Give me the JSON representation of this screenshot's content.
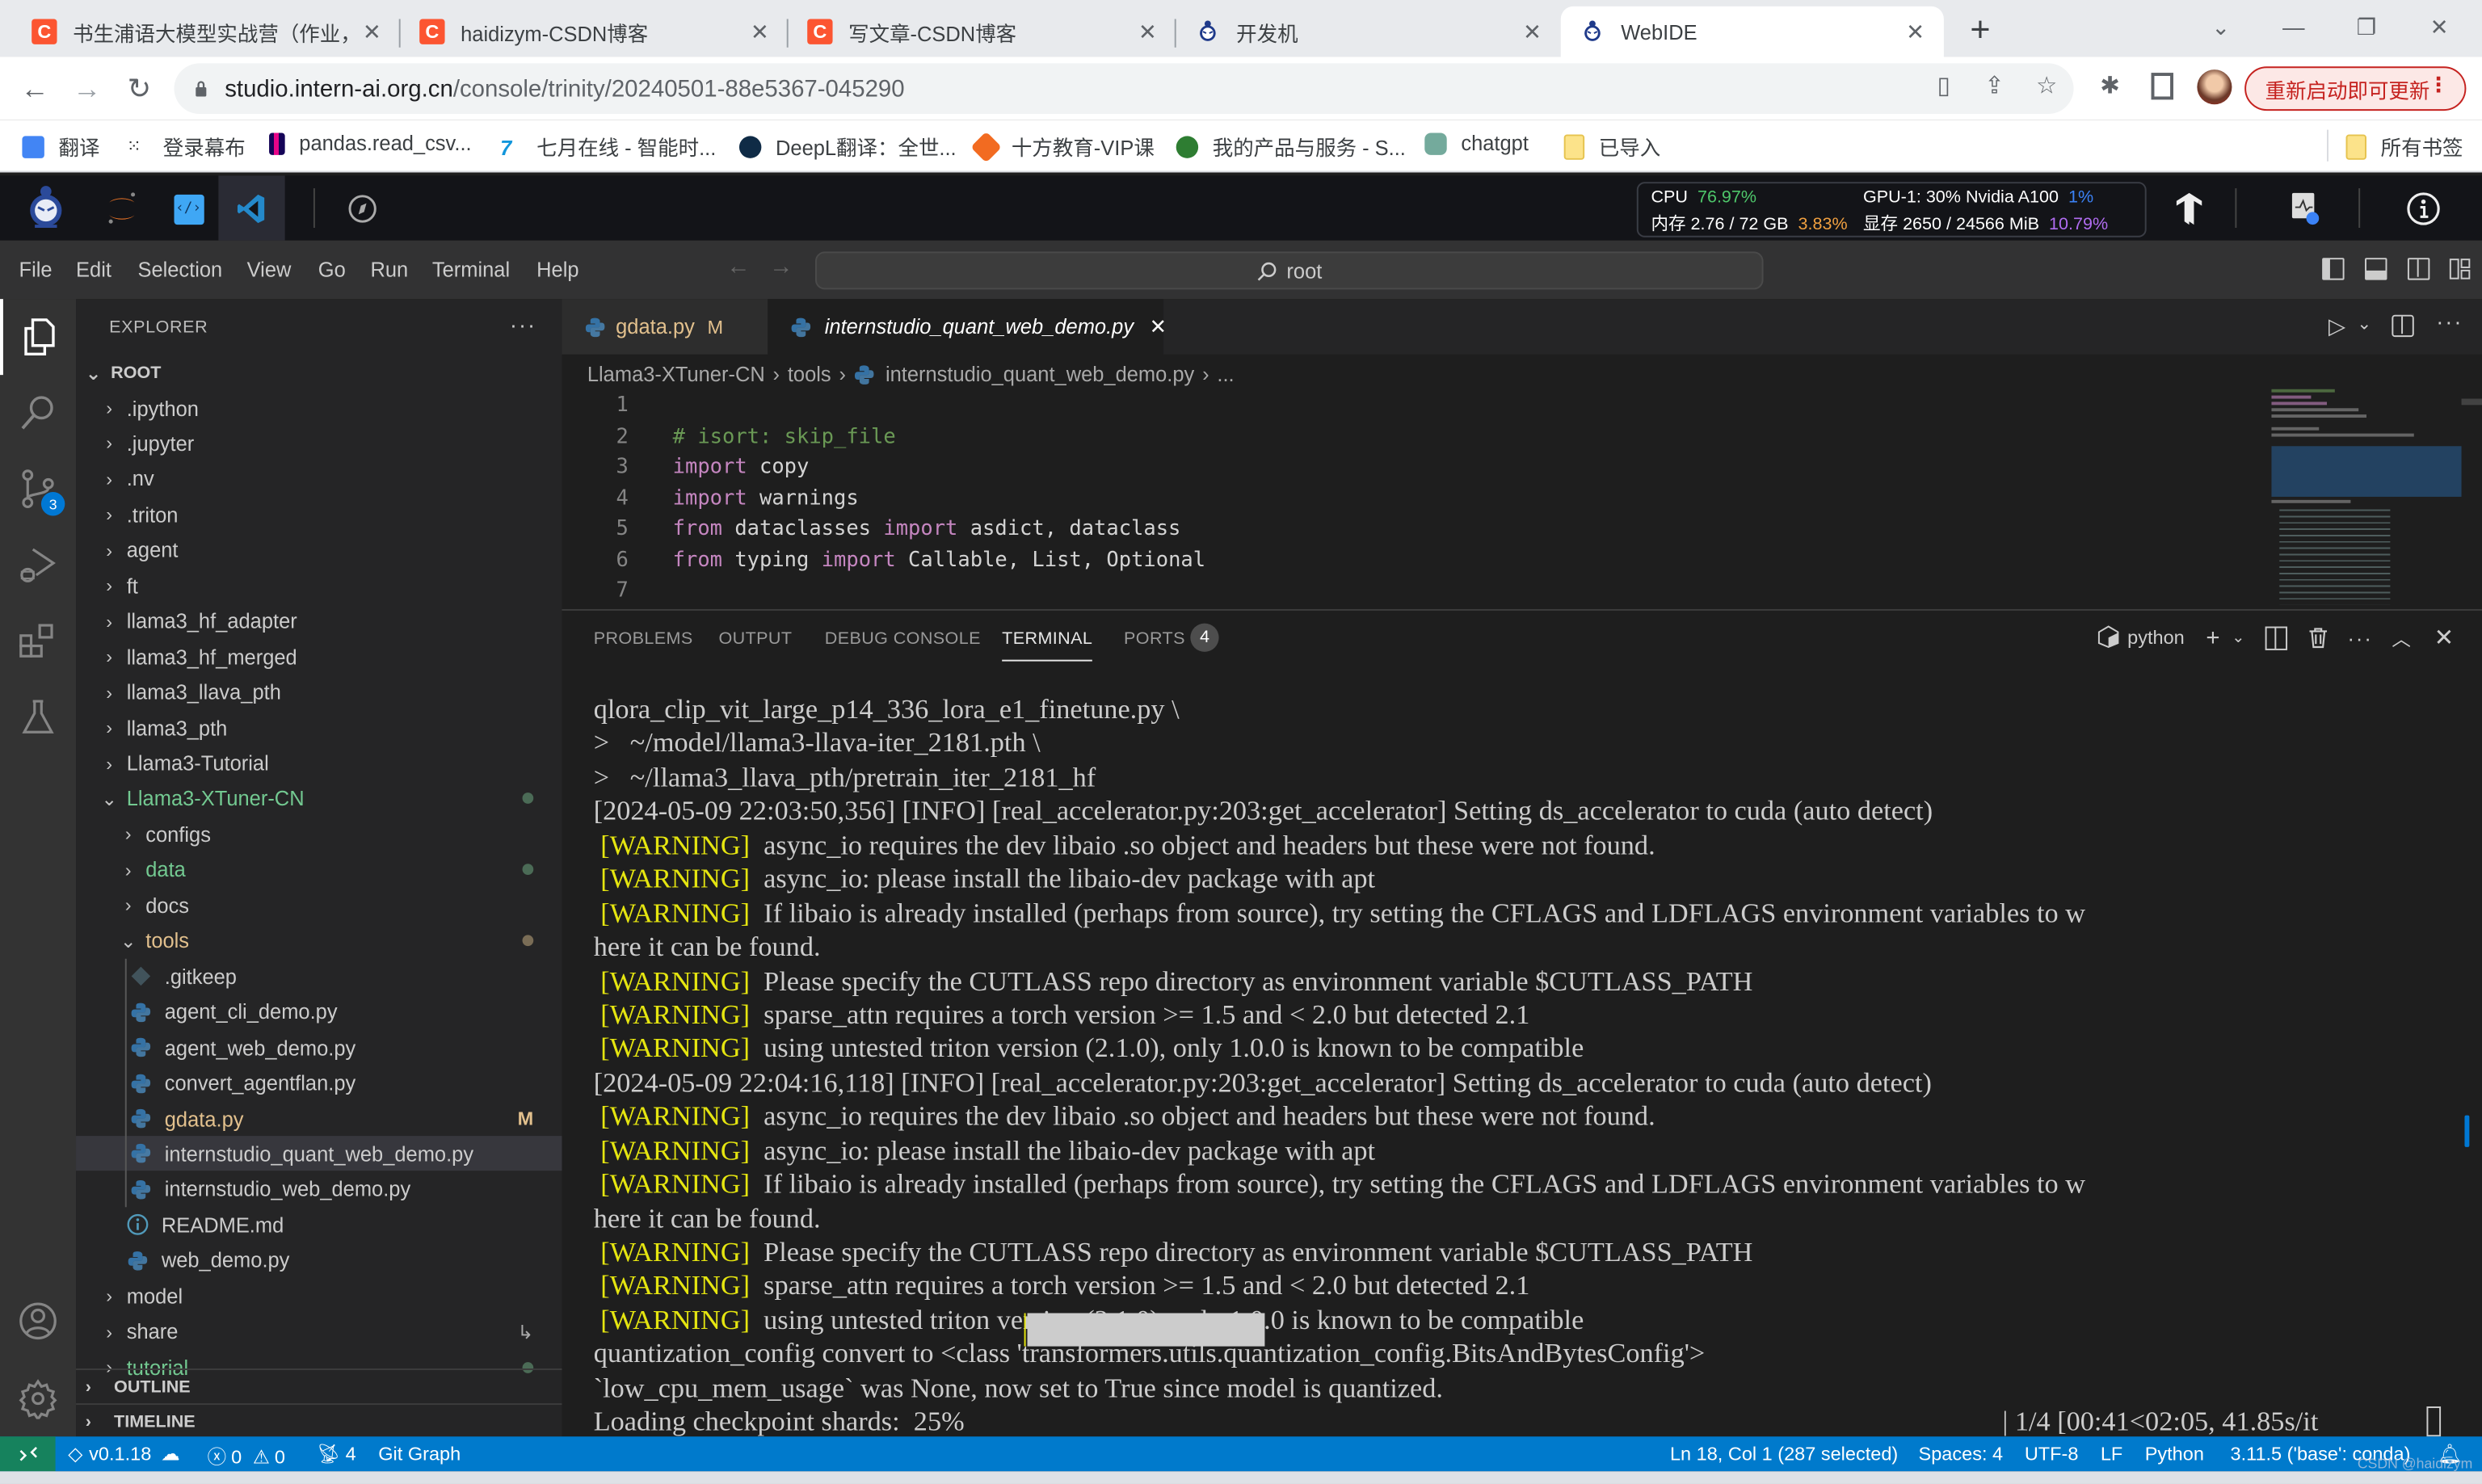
{
  "browser": {
    "tabs": [
      {
        "title": "书生浦语大模型实战营（作业，",
        "favicon": "csdn-icon",
        "active": false
      },
      {
        "title": "haidizym-CSDN博客",
        "favicon": "csdn-icon",
        "active": false
      },
      {
        "title": "写文章-CSDN博客",
        "favicon": "csdn-icon",
        "active": false
      },
      {
        "title": "开发机",
        "favicon": "intern-monk-icon",
        "active": false
      },
      {
        "title": "WebIDE",
        "favicon": "intern-monk-icon",
        "active": true
      }
    ],
    "tab_close": "✕",
    "new_tab": "+",
    "window_controls": {
      "dropdown": "⌄",
      "minimize": "—",
      "restore": "❐",
      "close": "✕"
    },
    "url": {
      "host": "studio.intern-ai.org.cn",
      "path": "/console/trinity/20240501-88e5367-045290"
    },
    "update_button": "重新启动即可更新",
    "bookmarks": [
      {
        "label": "翻译",
        "icon": "google-translate-icon",
        "color": "#4285f4"
      },
      {
        "label": "登录幕布",
        "icon": "mubu-icon",
        "color": "#333333"
      },
      {
        "label": "pandas.read_csv...",
        "icon": "pandas-icon",
        "color": "#150458"
      },
      {
        "label": "七月在线 - 智能时...",
        "icon": "july-online-icon",
        "color": "#1296db"
      },
      {
        "label": "DeepL翻译：全世...",
        "icon": "deepl-icon",
        "color": "#0f2b46"
      },
      {
        "label": "十方教育-VIP课",
        "icon": "shifang-icon",
        "color": "#f26b21"
      },
      {
        "label": "我的产品与服务 - S...",
        "icon": "paper-plane-icon",
        "color": "#2e7d32"
      },
      {
        "label": "chatgpt",
        "icon": "chatgpt-icon",
        "color": "#74aa9c"
      },
      {
        "label": "已导入",
        "icon": "folder-icon",
        "color": "#fce38a"
      }
    ],
    "all_bookmarks": "所有书签"
  },
  "webide": {
    "monitor": {
      "cpu_label": "CPU",
      "cpu_value": "76.97%",
      "mem_label": "内存 2.76 / 72 GB",
      "mem_value": "3.83%",
      "gpu_label": "GPU-1: 30% Nvidia A100",
      "gpu_value": "1%",
      "vram_label": "显存 2650 / 24566 MiB",
      "vram_value": "10.79%"
    },
    "colors": {
      "cpu": "#4ec66a",
      "mem": "#f0a040",
      "gpu": "#3b82f6",
      "vram": "#b06cf0"
    }
  },
  "menubar": {
    "items": [
      "File",
      "Edit",
      "Selection",
      "View",
      "Go",
      "Run",
      "Terminal",
      "Help"
    ],
    "command_center": "root"
  },
  "activity_bar": {
    "scm_badge": "3"
  },
  "explorer": {
    "title": "EXPLORER",
    "more": "···",
    "root_label": "ROOT",
    "items": [
      {
        "label": ".ipython",
        "type": "folder",
        "depth": 1
      },
      {
        "label": ".jupyter",
        "type": "folder",
        "depth": 1
      },
      {
        "label": ".nv",
        "type": "folder",
        "depth": 1
      },
      {
        "label": ".triton",
        "type": "folder",
        "depth": 1
      },
      {
        "label": "agent",
        "type": "folder",
        "depth": 1
      },
      {
        "label": "ft",
        "type": "folder",
        "depth": 1
      },
      {
        "label": "llama3_hf_adapter",
        "type": "folder",
        "depth": 1
      },
      {
        "label": "llama3_hf_merged",
        "type": "folder",
        "depth": 1
      },
      {
        "label": "llama3_llava_pth",
        "type": "folder",
        "depth": 1
      },
      {
        "label": "llama3_pth",
        "type": "folder",
        "depth": 1
      },
      {
        "label": "Llama3-Tutorial",
        "type": "folder",
        "depth": 1
      },
      {
        "label": "Llama3-XTuner-CN",
        "type": "folder-open",
        "depth": 1,
        "status": "untracked-dot"
      },
      {
        "label": "configs",
        "type": "folder",
        "depth": 2
      },
      {
        "label": "data",
        "type": "folder",
        "depth": 2,
        "status": "untracked-dot"
      },
      {
        "label": "docs",
        "type": "folder",
        "depth": 2
      },
      {
        "label": "tools",
        "type": "folder-open",
        "depth": 2,
        "status": "modified-dot"
      },
      {
        "label": ".gitkeep",
        "type": "git-file",
        "depth": 3
      },
      {
        "label": "agent_cli_demo.py",
        "type": "python-file",
        "depth": 3
      },
      {
        "label": "agent_web_demo.py",
        "type": "python-file",
        "depth": 3
      },
      {
        "label": "convert_agentflan.py",
        "type": "python-file",
        "depth": 3
      },
      {
        "label": "gdata.py",
        "type": "python-file",
        "depth": 3,
        "status": "M"
      },
      {
        "label": "internstudio_quant_web_demo.py",
        "type": "python-file",
        "depth": 3,
        "selected": true
      },
      {
        "label": "internstudio_web_demo.py",
        "type": "python-file",
        "depth": 3
      },
      {
        "label": "README.md",
        "type": "info-file",
        "depth": 2
      },
      {
        "label": "web_demo.py",
        "type": "python-file",
        "depth": 2
      },
      {
        "label": "model",
        "type": "folder",
        "depth": 1
      },
      {
        "label": "share",
        "type": "folder",
        "depth": 1,
        "status": "symlink"
      },
      {
        "label": "tutorial",
        "type": "folder",
        "depth": 1,
        "status": "untracked-dot"
      }
    ],
    "sections": [
      "OUTLINE",
      "TIMELINE"
    ]
  },
  "editor": {
    "tabs": [
      {
        "label": "gdata.py",
        "status": "M",
        "active": false
      },
      {
        "label": "internstudio_quant_web_demo.py",
        "active": true,
        "close": "✕"
      }
    ],
    "breadcrumb": [
      "Llama3-XTuner-CN",
      "tools",
      "internstudio_quant_web_demo.py",
      "..."
    ],
    "lines": [
      {
        "n": "1",
        "tokens": []
      },
      {
        "n": "2",
        "tokens": [
          {
            "t": "# isort: skip_file",
            "c": "cm"
          }
        ]
      },
      {
        "n": "3",
        "tokens": [
          {
            "t": "import",
            "c": "kw"
          },
          {
            "t": " copy",
            "c": "id"
          }
        ]
      },
      {
        "n": "4",
        "tokens": [
          {
            "t": "import",
            "c": "kw"
          },
          {
            "t": " warnings",
            "c": "id"
          }
        ]
      },
      {
        "n": "5",
        "tokens": [
          {
            "t": "from",
            "c": "kw"
          },
          {
            "t": " dataclasses ",
            "c": "id"
          },
          {
            "t": "import",
            "c": "kw"
          },
          {
            "t": " asdict, dataclass",
            "c": "id"
          }
        ]
      },
      {
        "n": "6",
        "tokens": [
          {
            "t": "from",
            "c": "kw"
          },
          {
            "t": " typing ",
            "c": "id"
          },
          {
            "t": "import",
            "c": "kw"
          },
          {
            "t": " Callable, List, Optional",
            "c": "id"
          }
        ]
      },
      {
        "n": "7",
        "tokens": []
      }
    ]
  },
  "panel": {
    "tabs": [
      "PROBLEMS",
      "OUTPUT",
      "DEBUG CONSOLE",
      "TERMINAL",
      "PORTS"
    ],
    "active_tab": "TERMINAL",
    "ports_count": "4",
    "terminal_name": "python",
    "terminal_lines": [
      {
        "text": "qlora_clip_vit_large_p14_336_lora_e1_finetune.py \\"
      },
      {
        "text": ">   ~/model/llama3-llava-iter_2181.pth \\"
      },
      {
        "text": ">   ~/llama3_llava_pth/pretrain_iter_2181_hf"
      },
      {
        "text": "[2024-05-09 22:03:50,356] [INFO] [real_accelerator.py:203:get_accelerator] Setting ds_accelerator to cuda (auto detect)"
      },
      {
        "warn": "[WARNING]",
        "text": "  async_io requires the dev libaio .so object and headers but these were not found."
      },
      {
        "warn": "[WARNING]",
        "text": "  async_io: please install the libaio-dev package with apt"
      },
      {
        "warn": "[WARNING]",
        "text": "  If libaio is already installed (perhaps from source), try setting the CFLAGS and LDFLAGS environment variables to w"
      },
      {
        "text": "here it can be found."
      },
      {
        "warn": "[WARNING]",
        "text": "  Please specify the CUTLASS repo directory as environment variable $CUTLASS_PATH"
      },
      {
        "warn": "[WARNING]",
        "text": "  sparse_attn requires a torch version >= 1.5 and < 2.0 but detected 2.1"
      },
      {
        "warn": "[WARNING]",
        "text": "  using untested triton version (2.1.0), only 1.0.0 is known to be compatible"
      },
      {
        "text": "[2024-05-09 22:04:16,118] [INFO] [real_accelerator.py:203:get_accelerator] Setting ds_accelerator to cuda (auto detect)"
      },
      {
        "warn": "[WARNING]",
        "text": "  async_io requires the dev libaio .so object and headers but these were not found."
      },
      {
        "warn": "[WARNING]",
        "text": "  async_io: please install the libaio-dev package with apt"
      },
      {
        "warn": "[WARNING]",
        "text": "  If libaio is already installed (perhaps from source), try setting the CFLAGS and LDFLAGS environment variables to w"
      },
      {
        "text": "here it can be found."
      },
      {
        "warn": "[WARNING]",
        "text": "  Please specify the CUTLASS repo directory as environment variable $CUTLASS_PATH"
      },
      {
        "warn": "[WARNING]",
        "text": "  sparse_attn requires a torch version >= 1.5 and < 2.0 but detected 2.1"
      },
      {
        "warn": "[WARNING]",
        "text": "  using untested triton version (2.1.0), only 1.0.0 is known to be compatible"
      },
      {
        "text": "quantization_config convert to <class 'transformers.utils.quantization_config.BitsAndBytesConfig'>"
      },
      {
        "text": "`low_cpu_mem_usage` was None, now set to True since model is quantized."
      }
    ],
    "progress": {
      "label": "Loading checkpoint shards:  25%",
      "fraction": 0.25,
      "suffix": "| 1/4 [00:41<02:05, 41.85s/it"
    }
  },
  "statusbar": {
    "version": "v0.1.18",
    "errors": "0",
    "warnings": "0",
    "ports": "4",
    "git_graph": "Git Graph",
    "cursor": "Ln 18, Col 1 (287 selected)",
    "spaces": "Spaces: 4",
    "encoding": "UTF-8",
    "eol": "LF",
    "language": "Python",
    "interpreter": "3.11.5 ('base': conda)",
    "watermark": "CSDN @haidizym"
  }
}
